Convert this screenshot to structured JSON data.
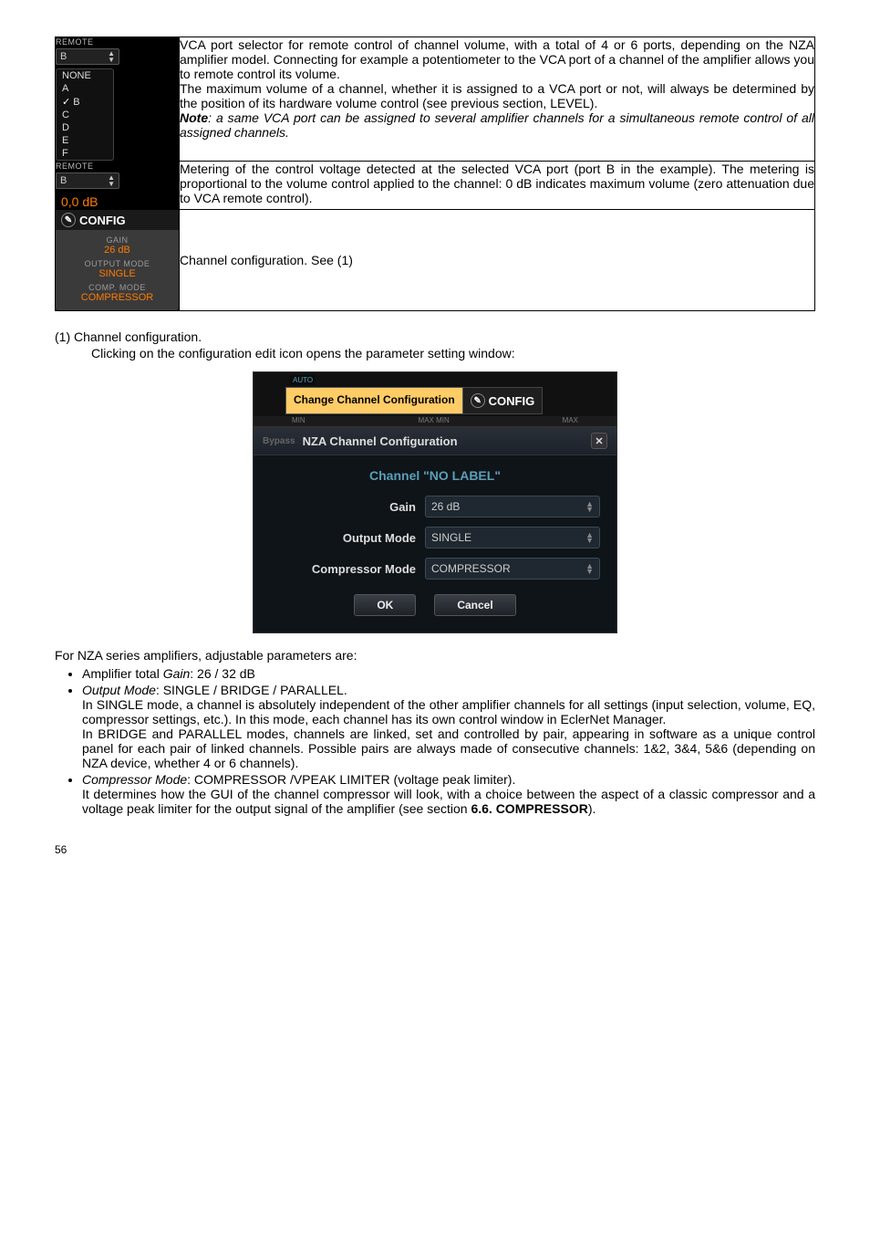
{
  "table": {
    "row1": {
      "remoteLabel": "REMOTE",
      "dropdownValue": "B",
      "menu": [
        "NONE",
        "A",
        "B",
        "C",
        "D",
        "E",
        "F"
      ],
      "checkedIndex": 2,
      "desc_p1": "VCA port selector for remote control of channel volume, with a total of 4 or 6 ports, depending on the NZA amplifier model. Connecting for example a potentiometer to the VCA port of a channel of the amplifier allows you to remote control its volume.",
      "desc_p2": "The maximum volume of a channel, whether it is assigned to a VCA port or not, will always be determined by the position of its hardware volume control (see previous section, LEVEL).",
      "noteLabel": "Note",
      "noteText": ": a same VCA port can be assigned to several amplifier channels for a simultaneous remote control of all assigned channels."
    },
    "row2": {
      "remoteLabel": "REMOTE",
      "dropdownValue": "B",
      "dbValue": "0,0 dB",
      "desc": "Metering of the control voltage detected at the selected VCA port (port B in the example). The metering is proportional to the volume control applied to the channel: 0 dB indicates maximum volume (zero attenuation due to VCA remote control)."
    },
    "row3": {
      "configTitle": "CONFIG",
      "gainLabel": "GAIN",
      "gainValue": "26 dB",
      "outputModeLabel": "OUTPUT MODE",
      "outputModeValue": "SINGLE",
      "compModeLabel": "COMP. MODE",
      "compModeValue": "COMPRESSOR",
      "desc": "Channel configuration. See (1)"
    }
  },
  "section": {
    "heading": "(1) Channel configuration.",
    "intro": "Clicking on the configuration edit icon opens the parameter setting window:"
  },
  "dialog": {
    "autoTag": "AUTO",
    "scale": {
      "min": "MIN",
      "maxmin": "MAX  MIN",
      "max": "MAX"
    },
    "tooltip": "Change Channel Configuration",
    "configSide": "CONFIG",
    "bypass": "Bypass",
    "title": "NZA Channel Configuration",
    "channelHeader": "Channel \"NO LABEL\"",
    "gainLabel": "Gain",
    "gainValue": "26 dB",
    "outputModeLabel": "Output Mode",
    "outputModeValue": "SINGLE",
    "compModeLabel": "Compressor Mode",
    "compModeValue": "COMPRESSOR",
    "okBtn": "OK",
    "cancelBtn": "Cancel"
  },
  "after": {
    "intro": "For NZA series amplifiers, adjustable parameters are:",
    "b1_pre": "Amplifier total ",
    "b1_it": "Gain",
    "b1_post": ": 26 / 32 dB",
    "b2_it": "Output Mode",
    "b2_post": ": SINGLE / BRIDGE / PARALLEL.",
    "b2_p1": "In SINGLE mode, a channel is absolutely independent of the other amplifier channels for all settings (input selection, volume, EQ, compressor settings, etc.). In this mode, each channel has its own control window in EclerNet Manager.",
    "b2_p2": "In BRIDGE and PARALLEL modes, channels are linked, set and controlled by pair, appearing in software as a unique control panel for each pair of linked channels. Possible pairs are always made of consecutive channels: 1&2, 3&4, 5&6 (depending on NZA device, whether 4 or 6 channels).",
    "b3_it": "Compressor Mode",
    "b3_post": ": COMPRESSOR /VPEAK LIMITER (voltage peak limiter).",
    "b3_p1_pre": "It determines how the GUI of the channel compressor will look, with a choice between the aspect of a classic compressor and a voltage peak limiter for the output signal of the amplifier (see section ",
    "b3_p1_bold": "6.6. COMPRESSOR",
    "b3_p1_post": ")."
  },
  "pageNum": "56"
}
